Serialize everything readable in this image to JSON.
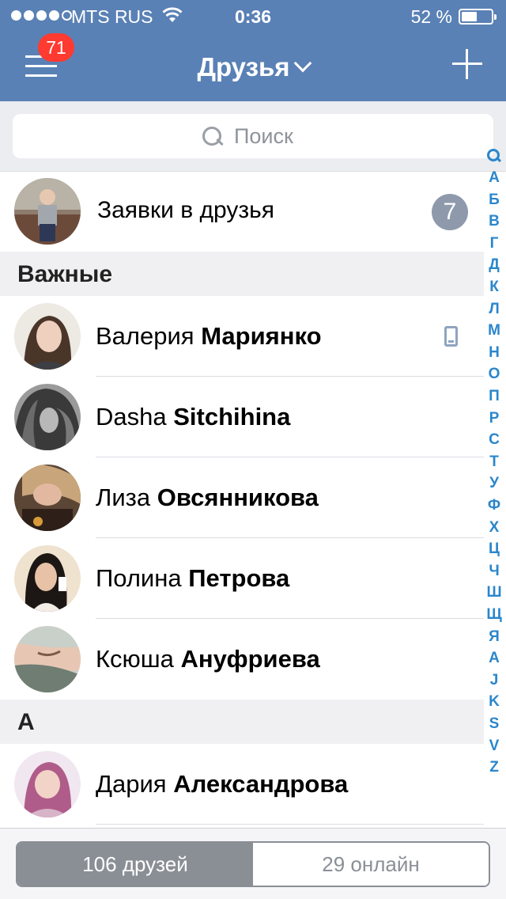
{
  "status_bar": {
    "carrier": "MTS RUS",
    "time": "0:36",
    "battery_percent": "52 %",
    "battery_level": 0.52
  },
  "nav": {
    "title": "Друзья",
    "menu_badge": "71"
  },
  "search": {
    "placeholder": "Поиск"
  },
  "requests": {
    "label": "Заявки в друзья",
    "count": "7"
  },
  "sections": [
    {
      "title": "Важные",
      "friends": [
        {
          "first": "Валерия",
          "last": "Мариянко",
          "mobile": true
        },
        {
          "first": "Dasha",
          "last": "Sitchihina",
          "mobile": false
        },
        {
          "first": "Лиза",
          "last": "Овсянникова",
          "mobile": false
        },
        {
          "first": "Полина",
          "last": "Петрова",
          "mobile": false
        },
        {
          "first": "Ксюша",
          "last": "Ануфриева",
          "mobile": false
        }
      ]
    },
    {
      "title": "А",
      "friends": [
        {
          "first": "Дария",
          "last": "Александрова",
          "mobile": false
        }
      ]
    }
  ],
  "index_letters": [
    "А",
    "Б",
    "В",
    "Г",
    "Д",
    "К",
    "Л",
    "М",
    "Н",
    "О",
    "П",
    "Р",
    "С",
    "Т",
    "У",
    "Ф",
    "Х",
    "Ц",
    "Ч",
    "Ш",
    "Щ",
    "Я",
    "A",
    "J",
    "K",
    "S",
    "V",
    "Z"
  ],
  "tabs": {
    "friends": "106 друзей",
    "online": "29 онлайн"
  }
}
